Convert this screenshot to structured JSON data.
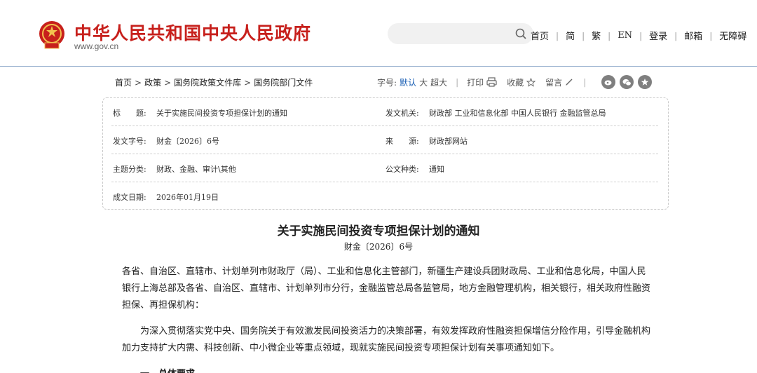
{
  "header": {
    "site_title": "中华人民共和国中央人民政府",
    "site_url": "www.gov.cn",
    "search": {
      "placeholder": ""
    },
    "nav": [
      "首页",
      "简",
      "繁",
      "EN",
      "登录",
      "邮箱",
      "无障碍"
    ]
  },
  "breadcrumb": [
    "首页",
    "政策",
    "国务院政策文件库",
    "国务院部门文件"
  ],
  "toolbar": {
    "font_size_label": "字号:",
    "font_sizes": [
      "默认",
      "大",
      "超大"
    ],
    "print_label": "打印",
    "favorite_label": "收藏",
    "comment_label": "留言",
    "share_icons": [
      "weibo-icon",
      "wechat-icon",
      "star-icon"
    ]
  },
  "meta": {
    "title_key": "标　　题:",
    "title_val": "关于实施民间投资专项担保计划的通知",
    "issuer_key": "发文机关:",
    "issuer_val": "财政部 工业和信息化部 中国人民银行 金融监管总局",
    "docno_key": "发文字号:",
    "docno_val": "财金〔2026〕6号",
    "source_key": "来　　源:",
    "source_val": "财政部网站",
    "topic_key": "主题分类:",
    "topic_val": "财政、金融、审计\\其他",
    "type_key": "公文种类:",
    "type_val": "通知",
    "date_key": "成文日期:",
    "date_val": "2026年01月19日"
  },
  "article": {
    "title": "关于实施民间投资专项担保计划的通知",
    "doc_no": "财金〔2026〕6号",
    "p1": "各省、自治区、直辖市、计划单列市财政厅（局）、工业和信息化主管部门，新疆生产建设兵团财政局、工业和信息化局，中国人民银行上海总部及各省、自治区、直辖市、计划单列市分行，金融监管总局各监管局，地方金融管理机构，相关银行，相关政府性融资担保、再担保机构：",
    "p2": "为深入贯彻落实党中央、国务院关于有效激发民间投资活力的决策部署，有效发挥政府性融资担保增信分险作用，引导金融机构加力支持扩大内需、科技创新、中小微企业等重点领域，现就实施民间投资专项担保计划有关事项通知如下。",
    "p3": "一、总体要求"
  },
  "colors": {
    "brand_red": "#c7201c",
    "link_blue": "#1a5fb4",
    "divider": "#8aa6c8"
  }
}
